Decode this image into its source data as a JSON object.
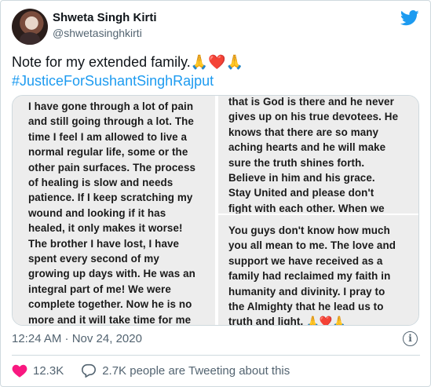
{
  "tweet": {
    "author_name": "Shweta Singh Kirti",
    "author_handle": "@shwetasinghkirti",
    "text_line1": "Note for my extended family.🙏❤️🙏",
    "hashtag": "#JusticeForSushantSinghRajput",
    "timestamp": "12:24 AM · Nov 24, 2020",
    "likes": "12.3K",
    "reply_text": "2.7K people are Tweeting about this"
  },
  "media": {
    "left_note": "I have gone through a lot of pain\nand still going through a lot. The\ntime I feel I am allowed to live a\nnormal regular life, some or the\nother pain surfaces. The process\nof healing is slow and needs\npatience. If I keep scratching my\nwound and looking if it has\nhealed, it only makes it worse!\nThe brother I have lost, I have\nspent every second of my\ngrowing up days with. He was an\nintegral part of me! We were\ncomplete together. Now he is no\nmore and it will take time for me\nto realize it and live with it.",
    "right_top_note": "that is God is there and he never\ngives up on his true devotees. He\nknows that there are so many\naching hearts and he will make\nsure the truth shines forth.\nBelieve in him and his grace.\nStay United and please don't\nfight with each other. When we",
    "right_bottom_note": "You guys don't know how much\nyou all mean to me. The love and\nsupport we have received as a\nfamily had reclaimed my faith in\nhumanity and divinity.  I pray to\nthe Almighty that he lead us to\ntruth and light. 🙏❤️🙏"
  },
  "colors": {
    "link_blue": "#1d9bf0",
    "like_red": "#f91880",
    "text_secondary": "#536471",
    "twitter_blue": "#1d9bf0"
  },
  "icons": [
    "twitter-bird-icon",
    "info-icon",
    "heart-icon",
    "comment-icon"
  ]
}
